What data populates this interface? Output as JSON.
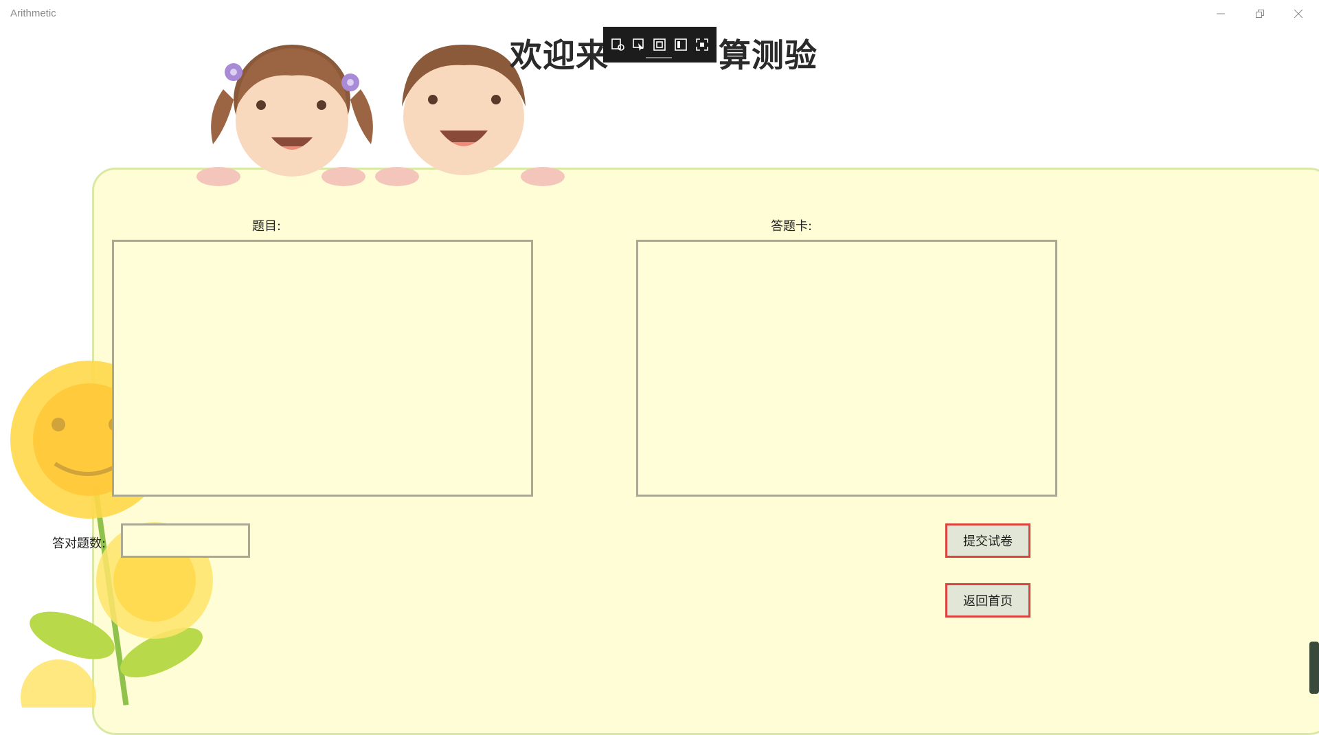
{
  "window": {
    "title": "Arithmetic",
    "controls": {
      "minimize_icon": "minimize-icon",
      "restore_icon": "restore-icon",
      "close_icon": "close-icon"
    }
  },
  "header": {
    "heading_visible_start": "欢迎来",
    "heading_visible_end": "算测验"
  },
  "overlay_toolbar": {
    "icons": [
      "capture-settings-icon",
      "select-element-icon",
      "frame-icon",
      "inspect-icon",
      "expand-icon"
    ]
  },
  "questions": {
    "label": "题目:"
  },
  "answer_card": {
    "label": "答题卡:"
  },
  "score": {
    "label": "答对题数:",
    "value": ""
  },
  "actions": {
    "submit_label": "提交试卷",
    "home_label": "返回首页"
  },
  "colors": {
    "panel_bg": "#fffdd6",
    "panel_border": "#d9e8a4",
    "button_border": "#d9443f",
    "button_bg": "#e2e6d6"
  }
}
